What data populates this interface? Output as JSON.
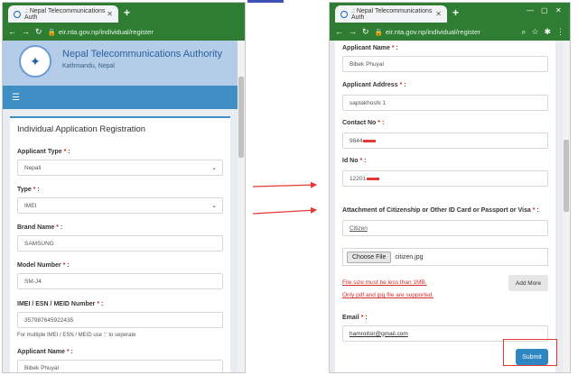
{
  "left_window": {
    "tab_title": ".: Nepal Telecommunications Auth",
    "url": "eir.nta.gov.np/individual/register",
    "org_title": "Nepal Telecommunications Authority",
    "org_subtitle": "Kathmandu, Nepal",
    "form_title": "Individual Application Registration",
    "fields": {
      "applicant_type_label": "Applicant Type",
      "applicant_type_value": "Nepali",
      "type_label": "Type",
      "type_value": "IMEI",
      "brand_label": "Brand Name",
      "brand_value": "SAMSUNG",
      "model_label": "Model Number",
      "model_value": "SM-J4",
      "imei_label": "IMEI / ESN / MEID Number",
      "imei_value": "357987645922435",
      "imei_help": "For multiple IMEI / ESN / MEID use ';' to seperate",
      "applicant_name_label": "Applicant Name",
      "applicant_name_value": "Bibek Phuyal"
    }
  },
  "right_window": {
    "tab_title": ".: Nepal Telecommunications Auth",
    "url": "eir.nta.gov.np/individual/register",
    "fields": {
      "applicant_name_label": "Applicant Name",
      "applicant_name_value": "Bibek Phuyal",
      "address_label": "Applicant Address",
      "address_value": "saptakhoshi 1",
      "contact_label": "Contact No",
      "contact_value": "9844",
      "id_label": "Id No",
      "id_value": "12201",
      "attachment_label": "Attachment of Citizenship or Other ID Card or Passport or Visa",
      "attachment_value": "Citizen",
      "choose_file_label": "Choose File",
      "chosen_file": "citizen.jpg",
      "size_warning": "File size must be less than 1MB.",
      "type_warning": "Only pdf and jpg file are supported.",
      "add_more_label": "Add More",
      "email_label": "Email",
      "email_value": "hamroitsir@gmail.com",
      "submit_label": "Submit"
    }
  },
  "required_marker": "*",
  "colors": {
    "browser_chrome": "#2e7d32",
    "nav_bar": "#3f8fc4",
    "header_band": "#b3cde8",
    "submit_button": "#2e86c1",
    "annotation_red": "#e53935"
  }
}
